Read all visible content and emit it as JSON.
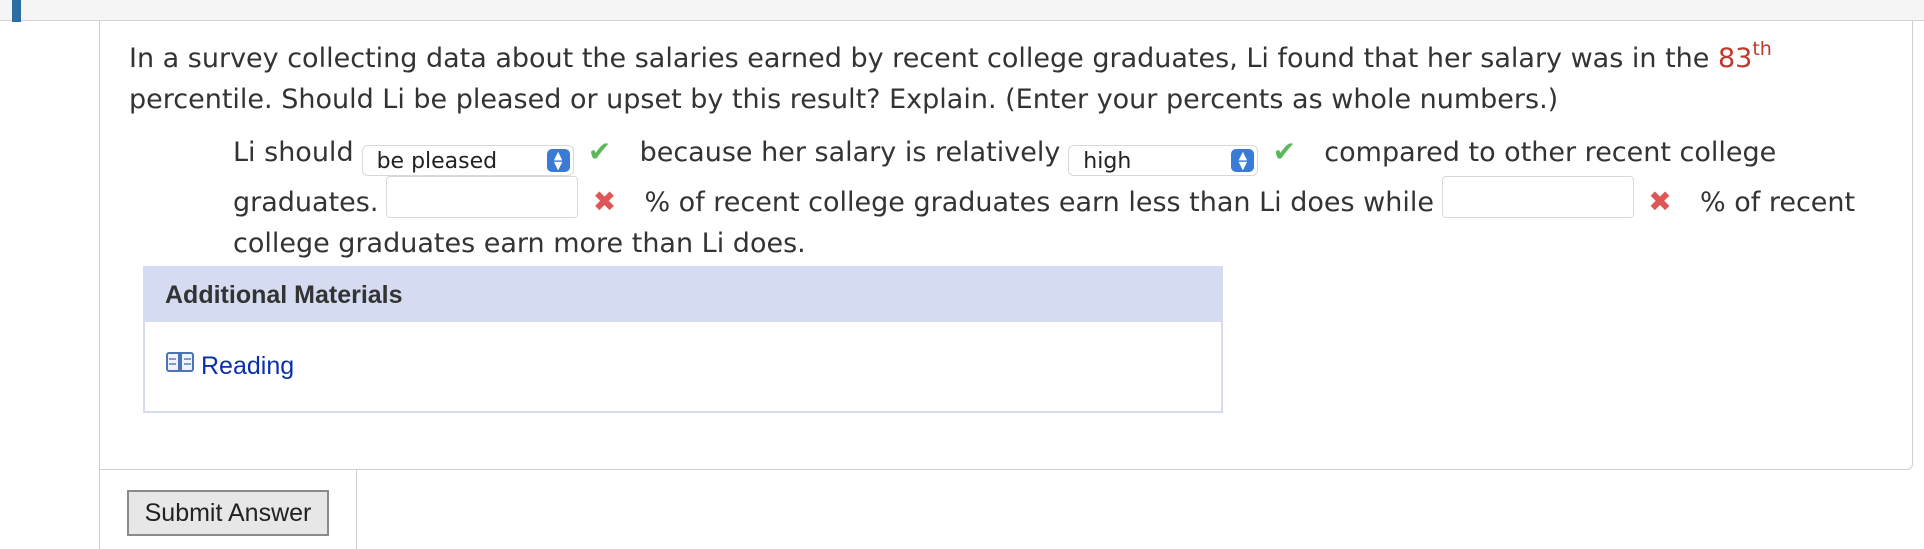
{
  "question": {
    "text_before": "In a survey collecting data about the salaries earned by recent college graduates, Li found that her salary was in the ",
    "percentile_value": "83",
    "percentile_suffix": "th",
    "text_after": " percentile. Should Li be pleased or upset by this result? Explain. (Enter your percents as whole numbers.)"
  },
  "answer": {
    "prefix": "Li should",
    "select1": {
      "value": "be pleased",
      "status": "correct"
    },
    "middle": "because her salary is relatively",
    "select2": {
      "value": "high",
      "status": "correct"
    },
    "after_select2": "compared to other recent college graduates.",
    "input1": {
      "value": "",
      "status": "incorrect"
    },
    "after_input1": "% of recent college graduates earn less than Li does while",
    "input2": {
      "value": "",
      "status": "incorrect"
    },
    "after_input2": "% of recent college graduates earn more than Li does."
  },
  "materials": {
    "header": "Additional Materials",
    "link_label": "Reading",
    "link_icon": "book-icon"
  },
  "submit": {
    "label": "Submit Answer"
  },
  "colors": {
    "accent": "#2e6da4",
    "percentile": "#c0392b",
    "correct": "#5cb85c",
    "incorrect": "#e05555",
    "materials_header_bg": "#d5dcf1",
    "link": "#0b2fa8"
  }
}
